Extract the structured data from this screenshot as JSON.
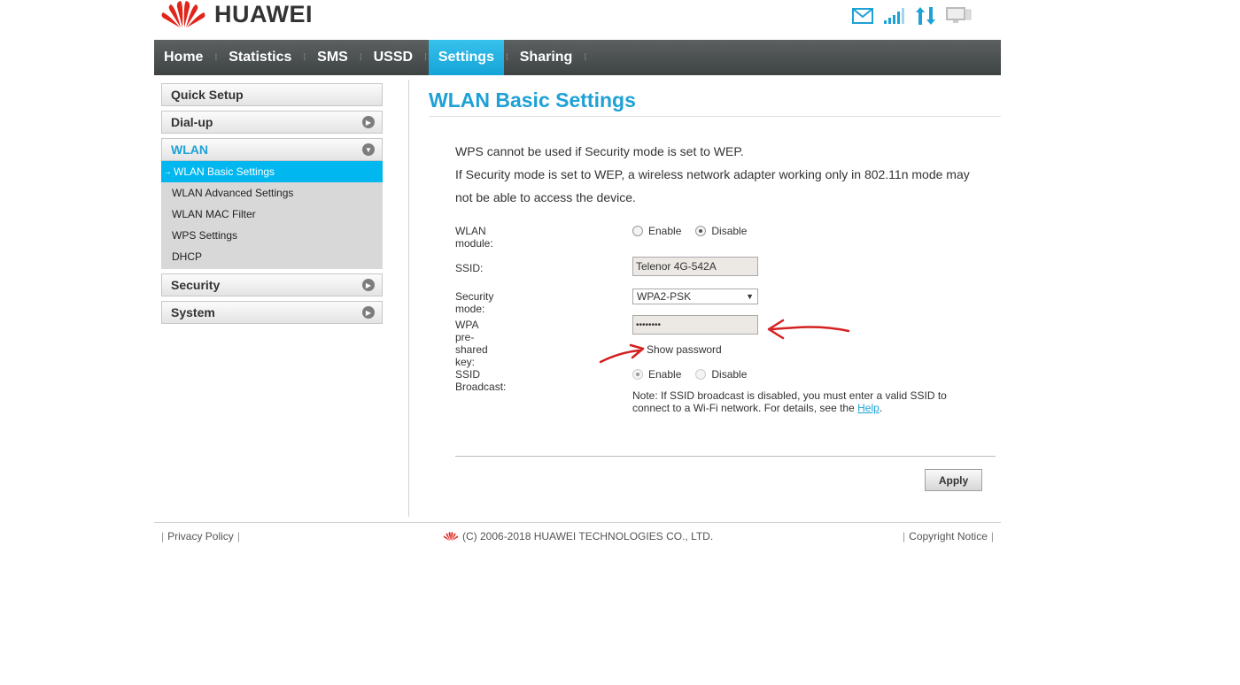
{
  "brand": {
    "name": "HUAWEI"
  },
  "nav": [
    "Home",
    "Statistics",
    "SMS",
    "USSD",
    "Settings",
    "Sharing"
  ],
  "nav_active": "Settings",
  "sidebar": {
    "quick_setup": "Quick Setup",
    "dialup": "Dial-up",
    "wlan": "WLAN",
    "wlan_items": [
      "WLAN Basic Settings",
      "WLAN Advanced Settings",
      "WLAN MAC Filter",
      "WPS Settings",
      "DHCP"
    ],
    "security": "Security",
    "system": "System"
  },
  "content": {
    "title": "WLAN Basic Settings",
    "note1": "WPS cannot be used if Security mode is set to WEP.",
    "note2": "If Security mode is set to WEP, a wireless network adapter working only in 802.11n mode may",
    "note3": "not be able to access the device.",
    "wlan_module_label": "WLAN module:",
    "enable": "Enable",
    "disable": "Disable",
    "ssid_label": "SSID:",
    "ssid_value": "Telenor 4G-542A",
    "security_mode_label": "Security mode:",
    "security_mode_value": "WPA2-PSK",
    "psk_label": "WPA pre-shared key:",
    "psk_value": "••••••••",
    "show_password": "Show password",
    "ssid_broadcast_label": "SSID Broadcast:",
    "help_note_1": "Note: If SSID broadcast is disabled, you must enter a valid SSID to",
    "help_note_2": "connect to a Wi-Fi network. For details, see the",
    "help_link": "Help",
    "apply": "Apply"
  },
  "footer": {
    "privacy": "Privacy Policy",
    "copyright": "(C) 2006-2018 HUAWEI TECHNOLOGIES CO., LTD.",
    "copyright_notice": "Copyright Notice"
  },
  "colors": {
    "accent": "#1ea1d6",
    "nav_bg": "#4a4f50",
    "annotation": "#d42020"
  },
  "icons": [
    "mail-icon",
    "signal-icon",
    "data-transfer-icon",
    "computer-icon"
  ]
}
